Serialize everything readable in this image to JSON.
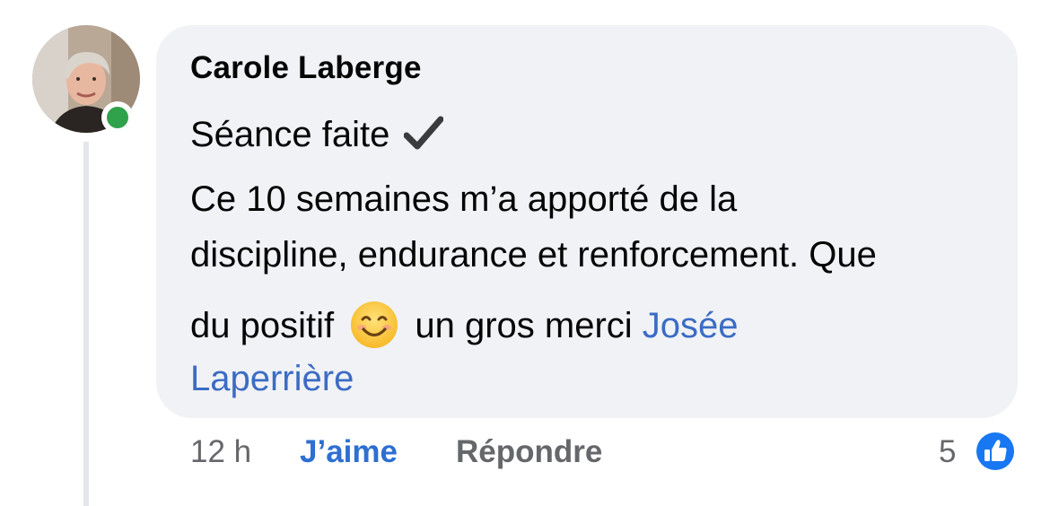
{
  "comment": {
    "author": "Carole Laberge",
    "line1": "Séance faite",
    "line2": "Ce 10 semaines m’a apporté de la",
    "line3": "discipline, endurance et renforcement. Que",
    "line4_before": "du positif",
    "line4_after": "un gros merci",
    "mention_part1": "Josée",
    "mention_part2": "Laperrière"
  },
  "actions": {
    "timestamp": "12 h",
    "like_label": "J’aime",
    "reply_label": "Répondre",
    "reaction_count": "5"
  },
  "icons": {
    "check": "check-icon",
    "smile": "smiling-face-emoji",
    "like": "thumbs-up-icon",
    "presence": "online-presence-dot"
  },
  "colors": {
    "bubble": "#f0f2f5",
    "link": "#3b6cc4",
    "online": "#31a24c",
    "like_badge": "#1877f2"
  }
}
